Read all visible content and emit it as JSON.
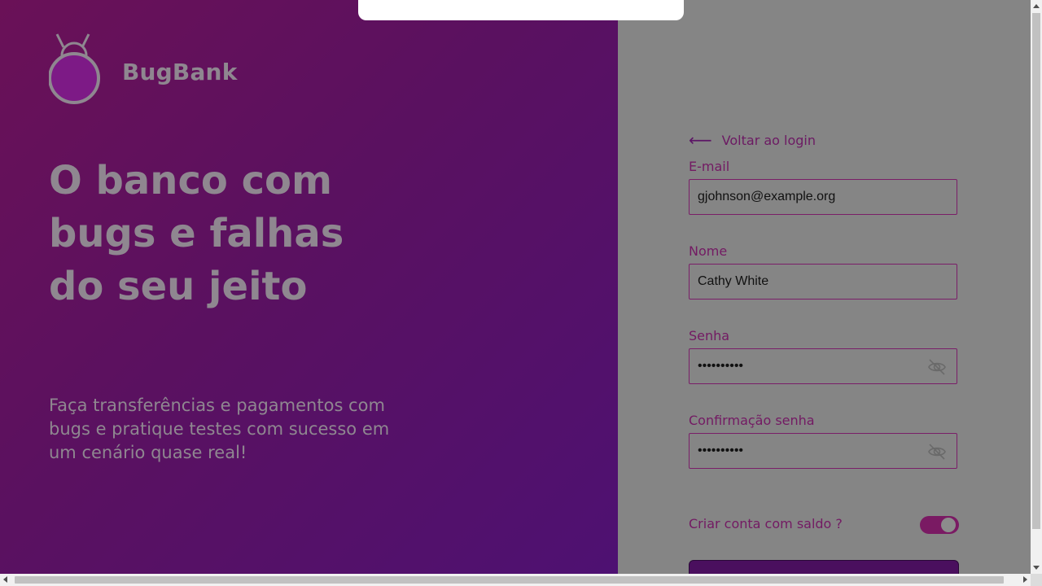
{
  "brand": {
    "name": "BugBank",
    "logo_icon": "bug-logo-icon"
  },
  "hero": {
    "title_lines": [
      "O banco com",
      "bugs e falhas",
      "do seu jeito"
    ],
    "subtitle": "Faça transferências e pagamentos com bugs e pratique testes com sucesso em um cenário quase real!"
  },
  "form": {
    "back_label": "Voltar ao login",
    "email": {
      "label": "E-mail",
      "value": "gjohnson@example.org"
    },
    "name": {
      "label": "Nome",
      "value": "Cathy White"
    },
    "password": {
      "label": "Senha",
      "value": "••••••••••"
    },
    "password_confirm": {
      "label": "Confirmação senha",
      "value": "••••••••••"
    },
    "balance_toggle": {
      "label": "Criar conta com saldo ?",
      "checked": true
    }
  },
  "colors": {
    "accent": "#731a63",
    "left_gradient_start": "#6a1157",
    "left_gradient_end": "#4e1172",
    "overlay_grey": "#858585"
  }
}
